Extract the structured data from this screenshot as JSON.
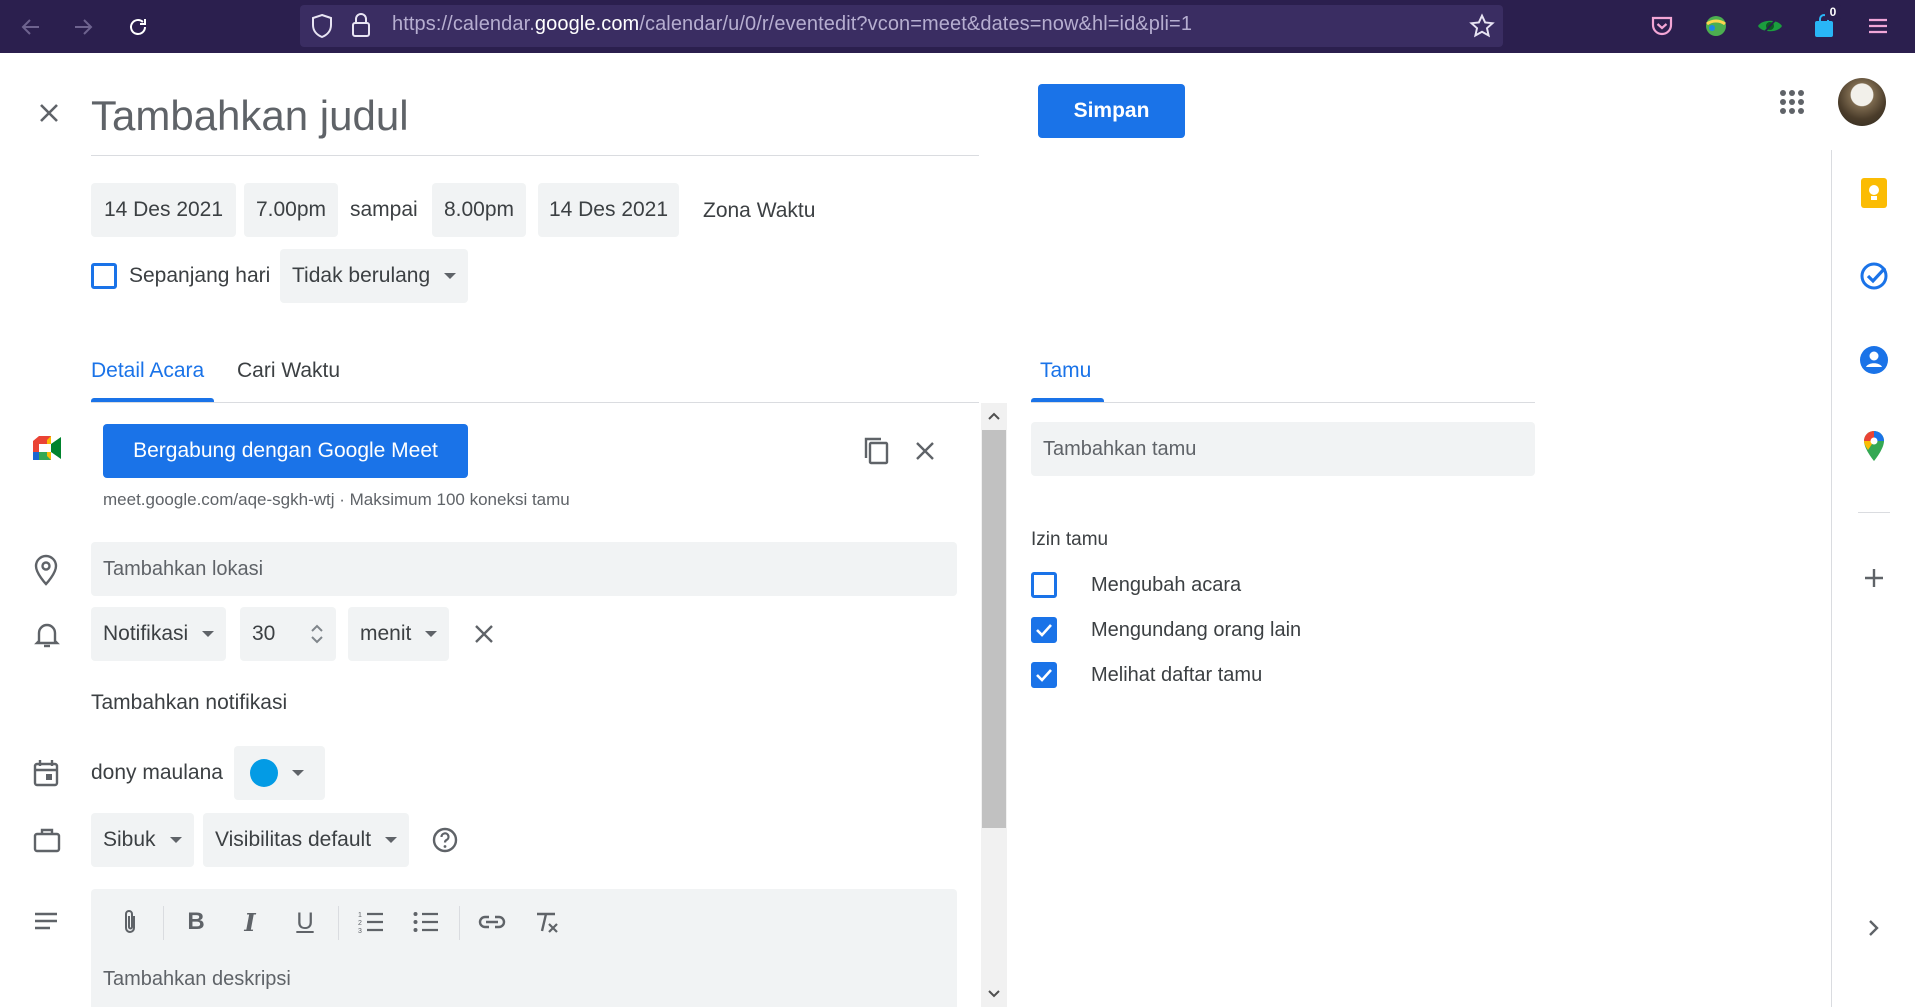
{
  "browser": {
    "url_prefix": "https://calendar.",
    "url_host": "google.com",
    "url_suffix": "/calendar/u/0/r/eventedit?vcon=meet&dates=now&hl=id&pli=1",
    "notification_badge": "0"
  },
  "header": {
    "title_placeholder": "Tambahkan judul",
    "save_label": "Simpan"
  },
  "datetime": {
    "start_date": "14 Des 2021",
    "start_time": "7.00pm",
    "separator": "sampai",
    "end_time": "8.00pm",
    "end_date": "14 Des 2021",
    "timezone_label": "Zona Waktu",
    "all_day_label": "Sepanjang hari",
    "repeat_label": "Tidak berulang"
  },
  "tabs": {
    "details": "Detail Acara",
    "find_time": "Cari Waktu",
    "guests": "Tamu"
  },
  "meet": {
    "join_label": "Bergabung dengan Google Meet",
    "info": "meet.google.com/aqe-sgkh-wtj · Maksimum 100 koneksi tamu"
  },
  "location": {
    "placeholder": "Tambahkan lokasi"
  },
  "notification": {
    "type": "Notifikasi",
    "value": "30",
    "unit": "menit",
    "add_label": "Tambahkan notifikasi"
  },
  "calendar": {
    "owner": "dony maulana",
    "color": "#039be5"
  },
  "availability": {
    "status": "Sibuk",
    "visibility": "Visibilitas default"
  },
  "description": {
    "placeholder": "Tambahkan deskripsi"
  },
  "guests": {
    "placeholder": "Tambahkan tamu",
    "permissions_title": "Izin tamu",
    "permissions": [
      {
        "label": "Mengubah acara",
        "checked": false
      },
      {
        "label": "Mengundang orang lain",
        "checked": true
      },
      {
        "label": "Melihat daftar tamu",
        "checked": true
      }
    ]
  },
  "colors": {
    "accent": "#1a73e8",
    "browser_bg": "#2b1f4e",
    "keep": "#fbbc04",
    "tasks": "#1a73e8",
    "contacts": "#1a73e8"
  }
}
